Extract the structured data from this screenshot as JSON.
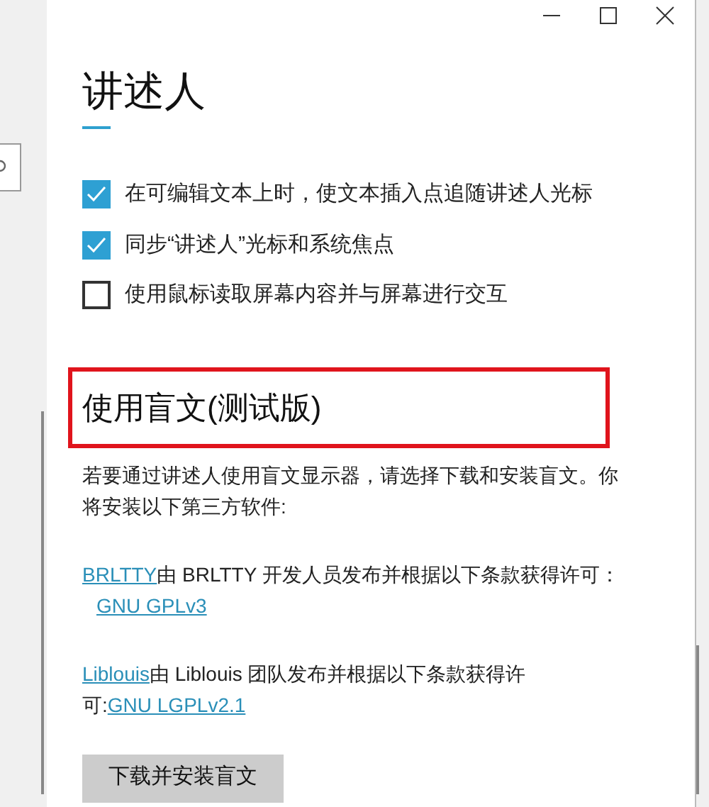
{
  "page_title": "讲述人",
  "options": [
    {
      "label": "在可编辑文本上时，使文本插入点追随讲述人光标",
      "checked": true
    },
    {
      "label": "同步“讲述人”光标和系统焦点",
      "checked": true
    },
    {
      "label": "使用鼠标读取屏幕内容并与屏幕进行交互",
      "checked": false
    }
  ],
  "braille": {
    "heading": "使用盲文(测试版)",
    "highlighted": true,
    "description": "若要通过讲述人使用盲文显示器，请选择下载和安装盲文。你将安装以下第三方软件:",
    "licenses": [
      {
        "name": "BRLTTY",
        "text": "由 BRLTTY 开发人员发布并根据以下条款获得许可：",
        "license": "GNU GPLv3"
      },
      {
        "name": "Liblouis",
        "text": "由 Liblouis 团队发布并根据以下条款获得许可:",
        "license": "GNU LGPLv2.1"
      }
    ],
    "button": "下载并安装盲文"
  }
}
